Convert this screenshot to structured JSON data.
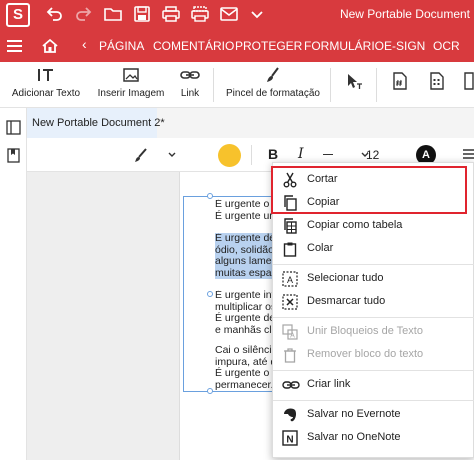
{
  "app": {
    "logo_letter": "S",
    "document_title": "New Portable Document"
  },
  "menu": {
    "items": [
      "PÁGINA",
      "COMENTÁRIO",
      "PROTEGER",
      "FORMULÁRIO",
      "E-SIGN",
      "OCR"
    ]
  },
  "ribbon": {
    "add_text": "Adicionar Texto",
    "insert_image": "Inserir Imagem",
    "link": "Link",
    "format_painter": "Pincel de formatação"
  },
  "tab": {
    "label": "New Portable Document 2*"
  },
  "format_bar": {
    "font_size": "12",
    "bold": "B",
    "italic": "I",
    "badge": "A",
    "highlight_color": "#f7c22c"
  },
  "document": {
    "paragraphs": [
      {
        "lines": [
          "É urgente o a",
          "É urgente un"
        ],
        "selected": false
      },
      {
        "lines": [
          "É urgente de",
          "ódio, solidão",
          "alguns lamen",
          "muitas espac"
        ],
        "selected": true
      },
      {
        "lines": [
          "É urgente inv",
          "multiplicar os",
          "É urgente des",
          "e manhãs cla"
        ],
        "selected": false
      },
      {
        "lines": [
          "Cai o silêncio",
          "impura, até d",
          "É urgente o a",
          "permanecer."
        ],
        "selected": false
      }
    ]
  },
  "context_menu": {
    "cut": "Cortar",
    "copy": "Copiar",
    "copy_as_table": "Copiar como tabela",
    "paste": "Colar",
    "select_all": "Selecionar tudo",
    "deselect_all": "Desmarcar tudo",
    "merge_text_blocks": "Unir Bloqueios de Texto",
    "remove_text_block": "Remover bloco do texto",
    "create_link": "Criar link",
    "save_evernote": "Salvar no Evernote",
    "save_onenote": "Salvar no OneNote"
  },
  "colors": {
    "brand": "#d83a3e",
    "selection": "#b8d1ef",
    "highlight_box": "#e0242e"
  }
}
